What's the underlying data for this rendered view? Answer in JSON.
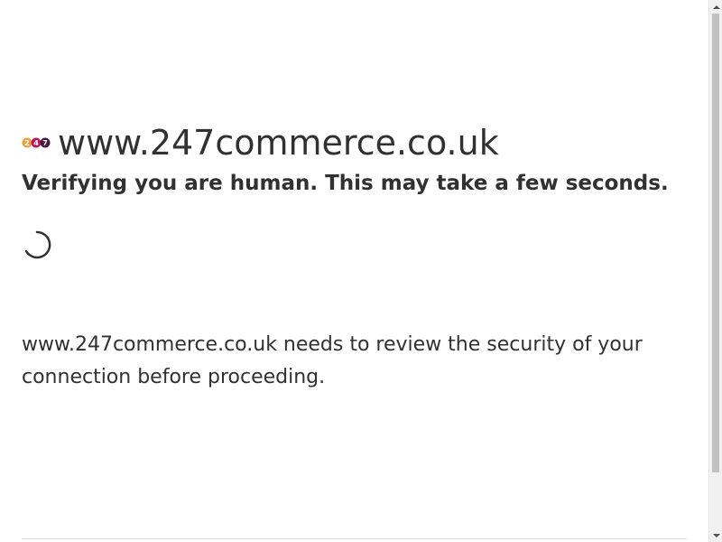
{
  "page": {
    "site_title": "www.247commerce.co.uk",
    "subtitle": "Verifying you are human. This may take a few seconds.",
    "message": "www.247commerce.co.uk needs to review the security of your connection before proceeding."
  },
  "favicon": {
    "icon": "247commerce-logo-icon",
    "glyphs": [
      "2",
      "4",
      "7"
    ],
    "colors": [
      "#e8a33d",
      "#c2185b",
      "#4a1942"
    ]
  },
  "spinner": {
    "icon": "loading-spinner-icon",
    "color": "#313131"
  },
  "scrollbar": {
    "up_icon": "scroll-up-arrow-icon",
    "down_icon": "scroll-down-arrow-icon"
  }
}
